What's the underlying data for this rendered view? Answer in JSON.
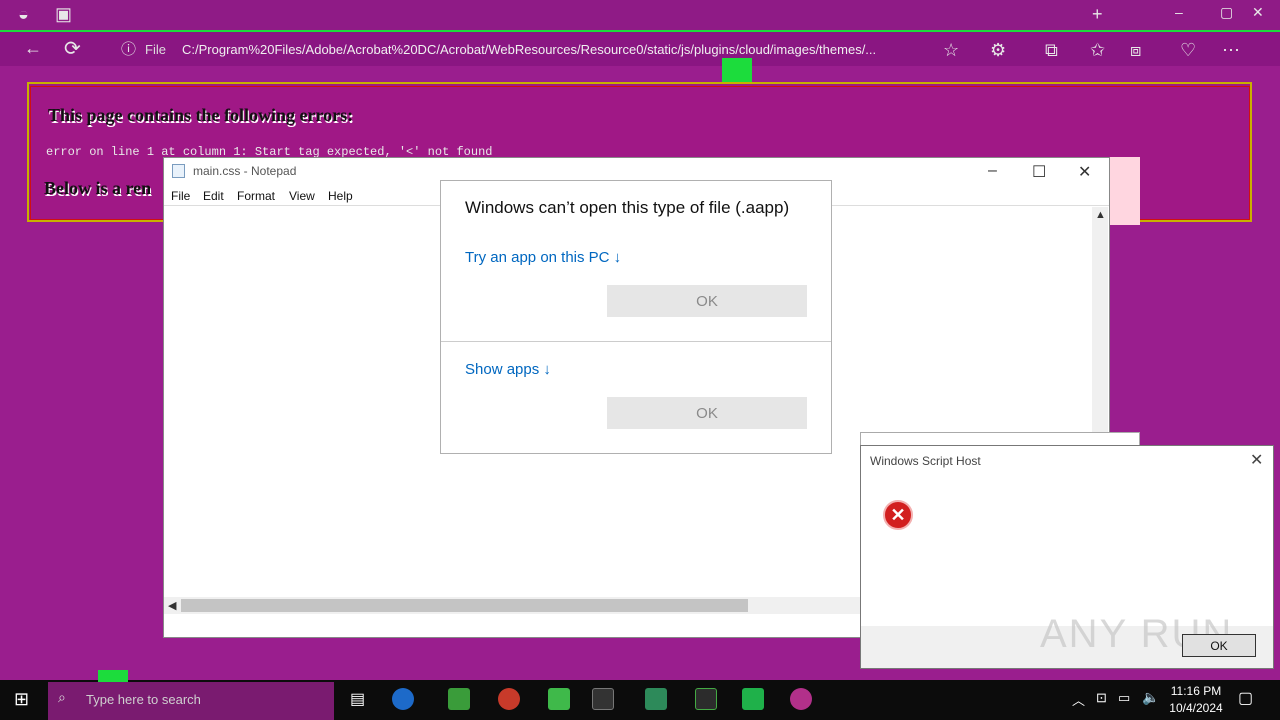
{
  "browser": {
    "address": "C:/Program%20Files/Adobe/Acrobat%20DC/Acrobat/WebResources/Resource0/static/js/plugins/cloud/images/themes/...",
    "file_label": "File"
  },
  "error_page": {
    "title": "This page contains the following errors:",
    "error_line": "error on line 1 at column 1: Start tag expected, '<' not found",
    "below": "Below is a ren"
  },
  "notepad": {
    "title": "main.css - Notepad",
    "menu": [
      "File",
      "Edit",
      "Format",
      "View",
      "Help"
    ]
  },
  "open_with": {
    "title": "Windows can’t open this type of file (.aapp)",
    "try_app": "Try an app on this PC ↓",
    "ok1": "OK",
    "show_apps": "Show apps ↓",
    "ok2": "OK"
  },
  "script_host": {
    "title": "Windows Script Host",
    "ok": "OK"
  },
  "watermark": "ANY RUN",
  "taskbar": {
    "search_placeholder": "Type here to search",
    "time": "11:16 PM",
    "date": "10/4/2024"
  },
  "colors": {
    "page_bg": "#9a1e8e",
    "link": "#0067c0",
    "error_red": "#d21f1f"
  }
}
